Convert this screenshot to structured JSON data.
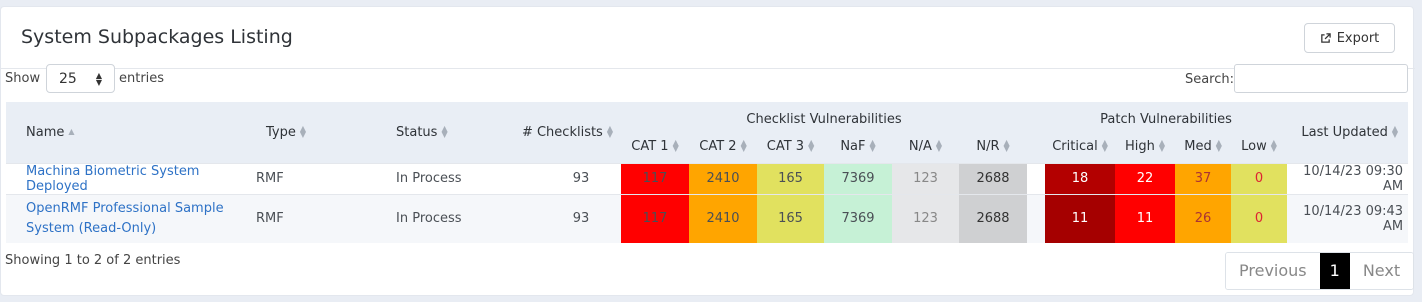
{
  "header": {
    "title": "System Subpackages Listing",
    "export_label": "Export"
  },
  "controls": {
    "show_label": "Show",
    "page_length": "25",
    "entries_label": "entries",
    "search_label": "Search:",
    "search_value": ""
  },
  "table": {
    "columns": {
      "name": "Name",
      "type": "Type",
      "status": "Status",
      "checklists": "# Checklists",
      "checklist_vuln_group": "Checklist Vulnerabilities",
      "cat1": "CAT 1",
      "cat2": "CAT 2",
      "cat3": "CAT 3",
      "naf": "NaF",
      "na": "N/A",
      "nr": "N/R",
      "patch_vuln_group": "Patch Vulnerabilities",
      "critical": "Critical",
      "high": "High",
      "med": "Med",
      "low": "Low",
      "last_updated": "Last Updated"
    },
    "rows": [
      {
        "name_line1": "Machina Biometric System Deployed",
        "name_line2": "",
        "type": "RMF",
        "status": "In Process",
        "checklists": "93",
        "cat1": "117",
        "cat2": "2410",
        "cat3": "165",
        "naf": "7369",
        "na": "123",
        "nr": "2688",
        "critical": "18",
        "high": "22",
        "med": "37",
        "low": "0",
        "last_updated": "10/14/23 09:30 AM"
      },
      {
        "name_line1": "OpenRMF Professional Sample",
        "name_line2": "System (Read-Only)",
        "type": "RMF",
        "status": "In Process",
        "checklists": "93",
        "cat1": "117",
        "cat2": "2410",
        "cat3": "165",
        "naf": "7369",
        "na": "123",
        "nr": "2688",
        "critical": "11",
        "high": "11",
        "med": "26",
        "low": "0",
        "last_updated": "10/14/23 09:43 AM"
      }
    ]
  },
  "footer": {
    "info": "Showing 1 to 2 of 2 entries",
    "previous": "Previous",
    "current_page": "1",
    "next": "Next"
  },
  "colors": {
    "cat1": "#ff0000",
    "cat2": "#ffa500",
    "cat3": "#e1e15f",
    "naf": "#c6f1d6",
    "na": "#e6e7e9",
    "nr": "#cfd0d2",
    "critical_row1": "#b30000",
    "critical_row2": "#a50000",
    "high": "#ff0000",
    "med": "#ffa500",
    "low": "#e1e15f",
    "link": "#2e72c6"
  }
}
